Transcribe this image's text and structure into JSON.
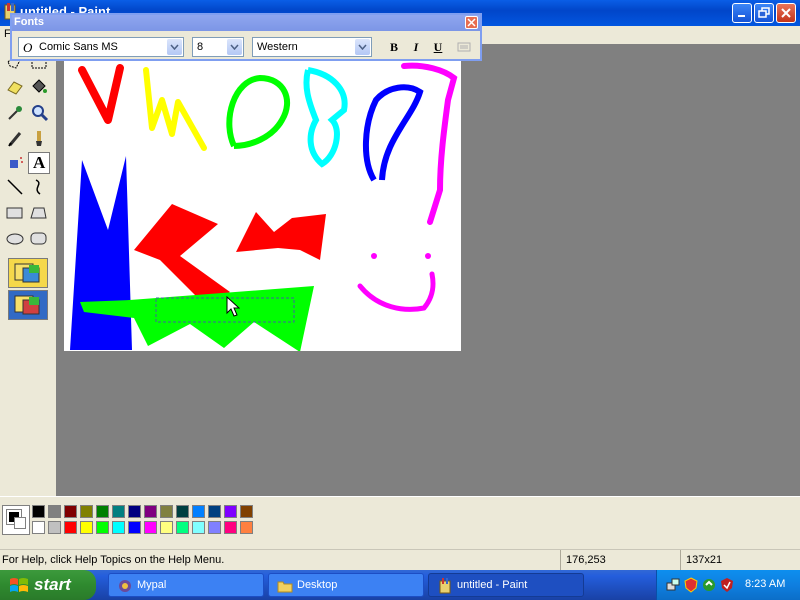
{
  "window": {
    "title": "untitled - Paint"
  },
  "menubar": {
    "first_visible": "F"
  },
  "fonts_toolbar": {
    "title": "Fonts",
    "font_name": "Comic Sans MS",
    "font_size": "8",
    "script": "Western",
    "bold_label": "B",
    "italic_label": "I",
    "underline_label": "U"
  },
  "tools": [
    "free-form-select",
    "select",
    "eraser",
    "fill-with-color",
    "pick-color",
    "magnifier",
    "pencil",
    "brush",
    "airbrush",
    "text",
    "line",
    "curve",
    "rectangle",
    "polygon",
    "ellipse",
    "rounded-rectangle"
  ],
  "selected_tool": "text",
  "palette": {
    "foreground": "#000000",
    "background": "#ffffff",
    "row1": [
      "#000000",
      "#808080",
      "#800000",
      "#808000",
      "#008000",
      "#008080",
      "#000080",
      "#800080",
      "#808040",
      "#004040",
      "#0080ff",
      "#004080",
      "#8000ff",
      "#804000"
    ],
    "row2": [
      "#ffffff",
      "#c0c0c0",
      "#ff0000",
      "#ffff00",
      "#00ff00",
      "#00ffff",
      "#0000ff",
      "#ff00ff",
      "#ffff80",
      "#00ff80",
      "#80ffff",
      "#8080ff",
      "#ff0080",
      "#ff8040"
    ]
  },
  "statusbar": {
    "help": "For Help, click Help Topics on the Help Menu.",
    "coords": "176,253",
    "size": "137x21"
  },
  "taskbar": {
    "start_label": "start",
    "tasks": [
      {
        "label": "Mypal",
        "active": false
      },
      {
        "label": "Desktop",
        "active": false
      },
      {
        "label": "untitled - Paint",
        "active": true
      }
    ],
    "clock": "8:23 AM"
  }
}
